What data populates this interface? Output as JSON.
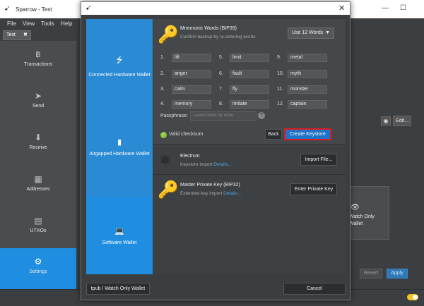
{
  "app": {
    "title": "Sparrow - Test",
    "menu": [
      "File",
      "View",
      "Tools",
      "Help"
    ],
    "tab_label": "Test",
    "sidebar": [
      {
        "label": "Transactions",
        "icon": "bitcoin-icon"
      },
      {
        "label": "Send",
        "icon": "send-icon"
      },
      {
        "label": "Receive",
        "icon": "receive-icon"
      },
      {
        "label": "Addresses",
        "icon": "addresses-icon"
      },
      {
        "label": "UTXOs",
        "icon": "utxos-icon"
      },
      {
        "label": "Settings",
        "icon": "settings-icon"
      }
    ],
    "edit_label": "Edit...",
    "watch_only_label": "Watch Only Wallet",
    "revert_label": "Revert",
    "apply_label": "Apply"
  },
  "dialog": {
    "nav": [
      {
        "label": "Connected Hardware Wallet",
        "icon": "usb-icon"
      },
      {
        "label": "Airgapped Hardware Wallet",
        "icon": "sdcard-icon"
      },
      {
        "label": "Software Wallet",
        "icon": "laptop-icon"
      }
    ],
    "bip39": {
      "title": "Mnemonic Words (BIP39)",
      "subtitle": "Confirm backup by re-entering words",
      "word_count_option": "Use 12 Words",
      "words": [
        {
          "num": "1.",
          "word": "lift"
        },
        {
          "num": "2.",
          "word": "anger"
        },
        {
          "num": "3.",
          "word": "calm"
        },
        {
          "num": "4.",
          "word": "memory"
        },
        {
          "num": "5.",
          "word": "limit"
        },
        {
          "num": "6.",
          "word": "fault"
        },
        {
          "num": "7.",
          "word": "fly"
        },
        {
          "num": "8.",
          "word": "imitate"
        },
        {
          "num": "9.",
          "word": "metal"
        },
        {
          "num": "10.",
          "word": "myth"
        },
        {
          "num": "11.",
          "word": "monster"
        },
        {
          "num": "12.",
          "word": "captain"
        }
      ],
      "passphrase_label": "Passphrase:",
      "passphrase_placeholder": "Leave blank for none",
      "checksum_status": "Valid checksum",
      "back_label": "Back",
      "create_label": "Create Keystore"
    },
    "electrum": {
      "title": "Electrum",
      "subtitle": "Keystore import",
      "details_link": "Details...",
      "button_label": "Import File..."
    },
    "xprv": {
      "title": "Master Private Key (BIP32)",
      "subtitle": "Extended key import",
      "details_link": "Details...",
      "button_label": "Enter Private Key"
    },
    "tpub_label": "tpub / Watch Only Wallet",
    "cancel_label": "Cancel"
  },
  "colors": {
    "accent": "#1f8de0",
    "highlight_border": "#e01b24",
    "valid": "#8cc63f"
  }
}
